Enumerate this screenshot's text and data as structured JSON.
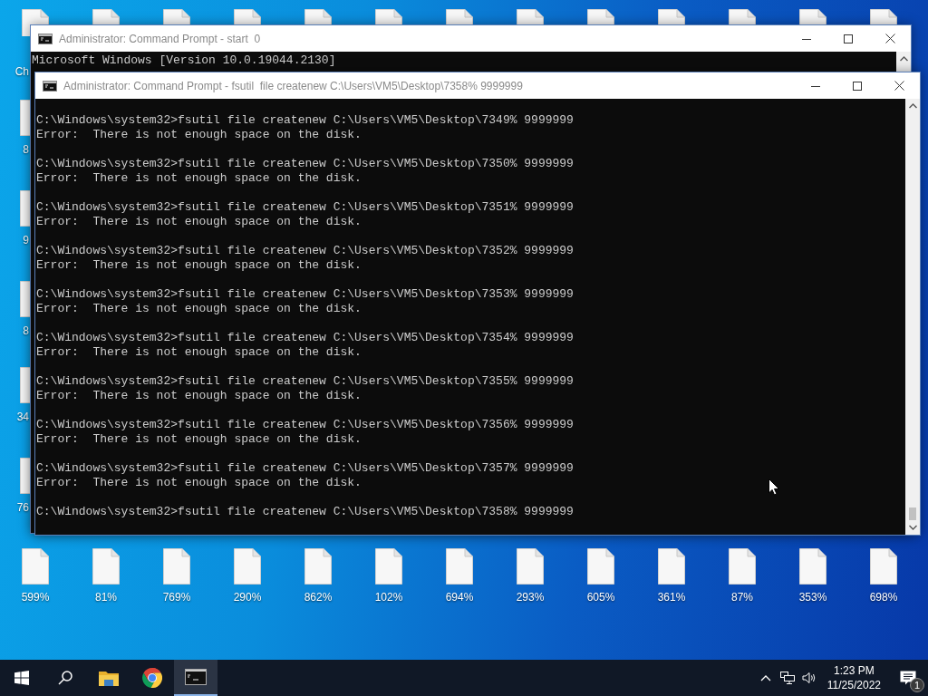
{
  "desktop": {
    "left_column": [
      {
        "label": "Ch"
      },
      {
        "label": "8"
      },
      {
        "label": "9"
      },
      {
        "label": "8"
      },
      {
        "label": "34"
      },
      {
        "label": "76"
      }
    ],
    "bottom_row": [
      {
        "label": "599%"
      },
      {
        "label": "81%"
      },
      {
        "label": "769%"
      },
      {
        "label": "290%"
      },
      {
        "label": "862%"
      },
      {
        "label": "102%"
      },
      {
        "label": "694%"
      },
      {
        "label": "293%"
      },
      {
        "label": "605%"
      },
      {
        "label": "361%"
      },
      {
        "label": "87%"
      },
      {
        "label": "353%"
      },
      {
        "label": "698%"
      }
    ]
  },
  "back_window": {
    "title": "Administrator: Command Prompt - start  0",
    "lines": [
      "Microsoft Windows [Version 10.0.19044.2130]"
    ]
  },
  "front_window": {
    "title": "Administrator: Command Prompt - fsutil  file createnew C:\\Users\\VM5\\Desktop\\7358% 9999999",
    "blocks": [
      {
        "command": "C:\\Windows\\system32>fsutil file createnew C:\\Users\\VM5\\Desktop\\7349% 9999999",
        "output": "Error:  There is not enough space on the disk."
      },
      {
        "command": "C:\\Windows\\system32>fsutil file createnew C:\\Users\\VM5\\Desktop\\7350% 9999999",
        "output": "Error:  There is not enough space on the disk."
      },
      {
        "command": "C:\\Windows\\system32>fsutil file createnew C:\\Users\\VM5\\Desktop\\7351% 9999999",
        "output": "Error:  There is not enough space on the disk."
      },
      {
        "command": "C:\\Windows\\system32>fsutil file createnew C:\\Users\\VM5\\Desktop\\7352% 9999999",
        "output": "Error:  There is not enough space on the disk."
      },
      {
        "command": "C:\\Windows\\system32>fsutil file createnew C:\\Users\\VM5\\Desktop\\7353% 9999999",
        "output": "Error:  There is not enough space on the disk."
      },
      {
        "command": "C:\\Windows\\system32>fsutil file createnew C:\\Users\\VM5\\Desktop\\7354% 9999999",
        "output": "Error:  There is not enough space on the disk."
      },
      {
        "command": "C:\\Windows\\system32>fsutil file createnew C:\\Users\\VM5\\Desktop\\7355% 9999999",
        "output": "Error:  There is not enough space on the disk."
      },
      {
        "command": "C:\\Windows\\system32>fsutil file createnew C:\\Users\\VM5\\Desktop\\7356% 9999999",
        "output": "Error:  There is not enough space on the disk."
      },
      {
        "command": "C:\\Windows\\system32>fsutil file createnew C:\\Users\\VM5\\Desktop\\7357% 9999999",
        "output": "Error:  There is not enough space on the disk."
      },
      {
        "command": "C:\\Windows\\system32>fsutil file createnew C:\\Users\\VM5\\Desktop\\7358% 9999999"
      }
    ]
  },
  "taskbar": {
    "apps": [
      {
        "kind": "start",
        "selected": false
      },
      {
        "kind": "search",
        "selected": false
      },
      {
        "kind": "explorer",
        "selected": false
      },
      {
        "kind": "browser",
        "selected": false
      },
      {
        "kind": "console",
        "selected": true
      }
    ],
    "clock": {
      "time": "1:23 PM",
      "date": "11/25/2022"
    },
    "notification_count": "1"
  }
}
